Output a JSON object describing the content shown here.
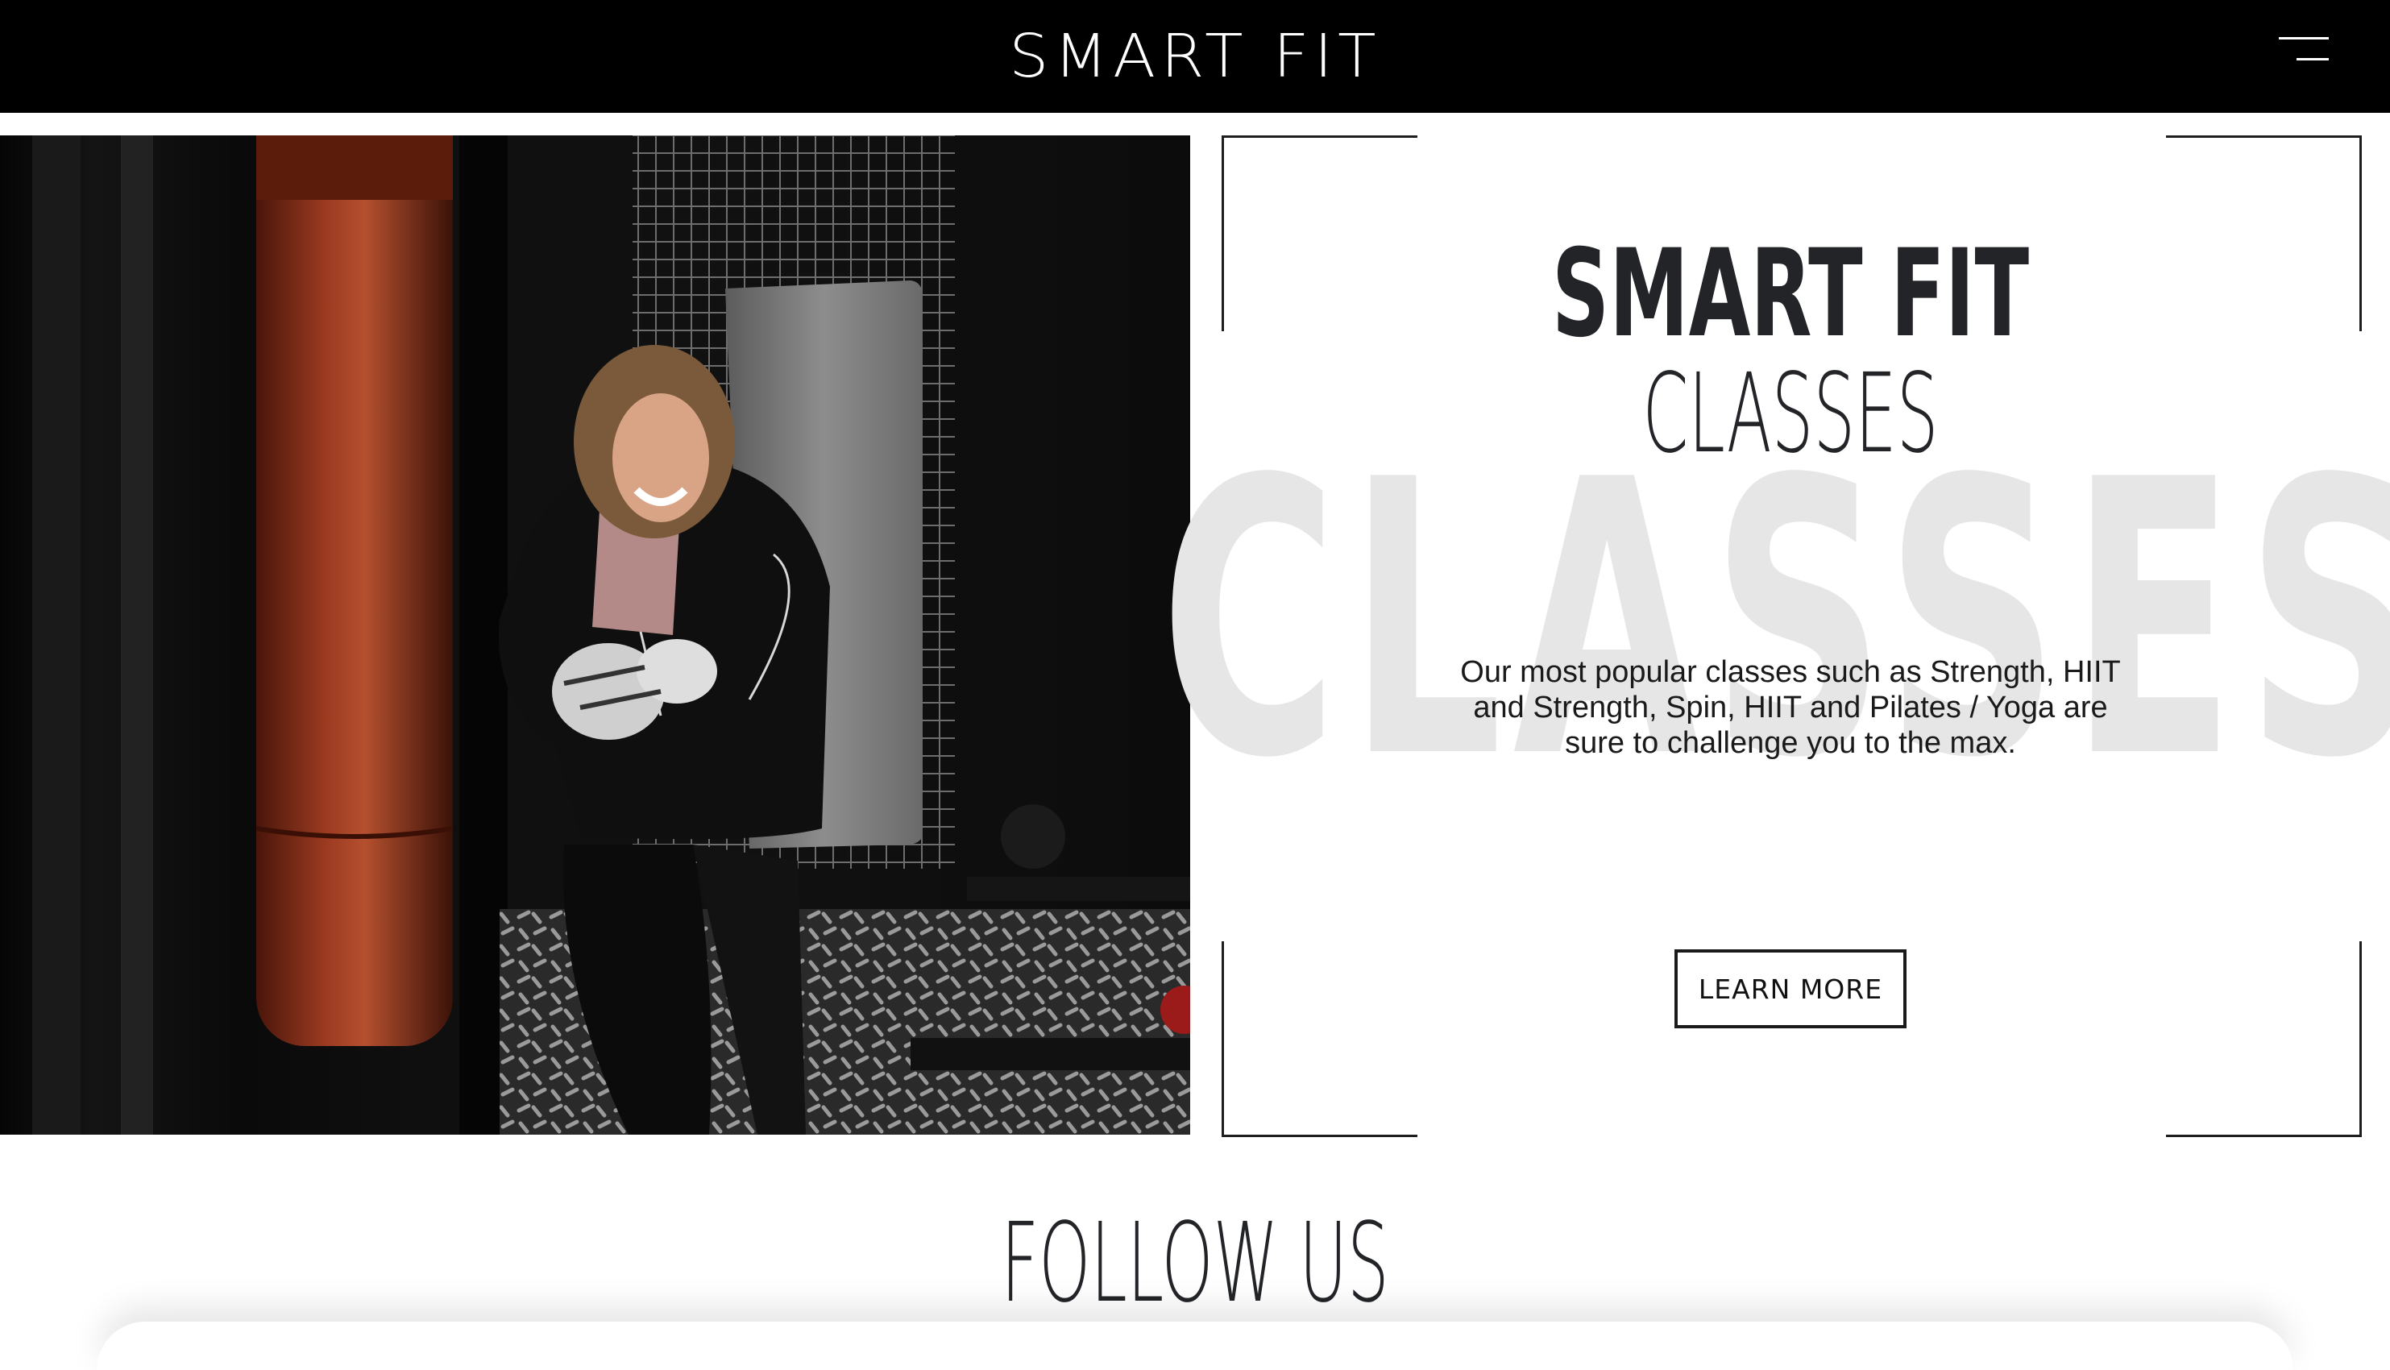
{
  "header": {
    "logo_text": "SMART FIT",
    "menu_icon": "hamburger-menu-icon"
  },
  "hero": {
    "image_alt": "Smiling woman wearing boxing gloves next to a punching bag in a gym"
  },
  "classes": {
    "title": "SMART FIT",
    "subtitle": "CLASSES",
    "watermark": "CLASSES",
    "description": "Our most popular classes such as Strength, HIIT and Strength, Spin, HIIT and Pilates / Yoga are sure to challenge you to the max.",
    "button_label": "LEARN MORE"
  },
  "follow": {
    "heading": "FOLLOW US"
  },
  "colors": {
    "header_bg": "#000000",
    "text_dark": "#222428",
    "watermark": "#e6e6e6",
    "punching_bag": "#8a2f18"
  }
}
